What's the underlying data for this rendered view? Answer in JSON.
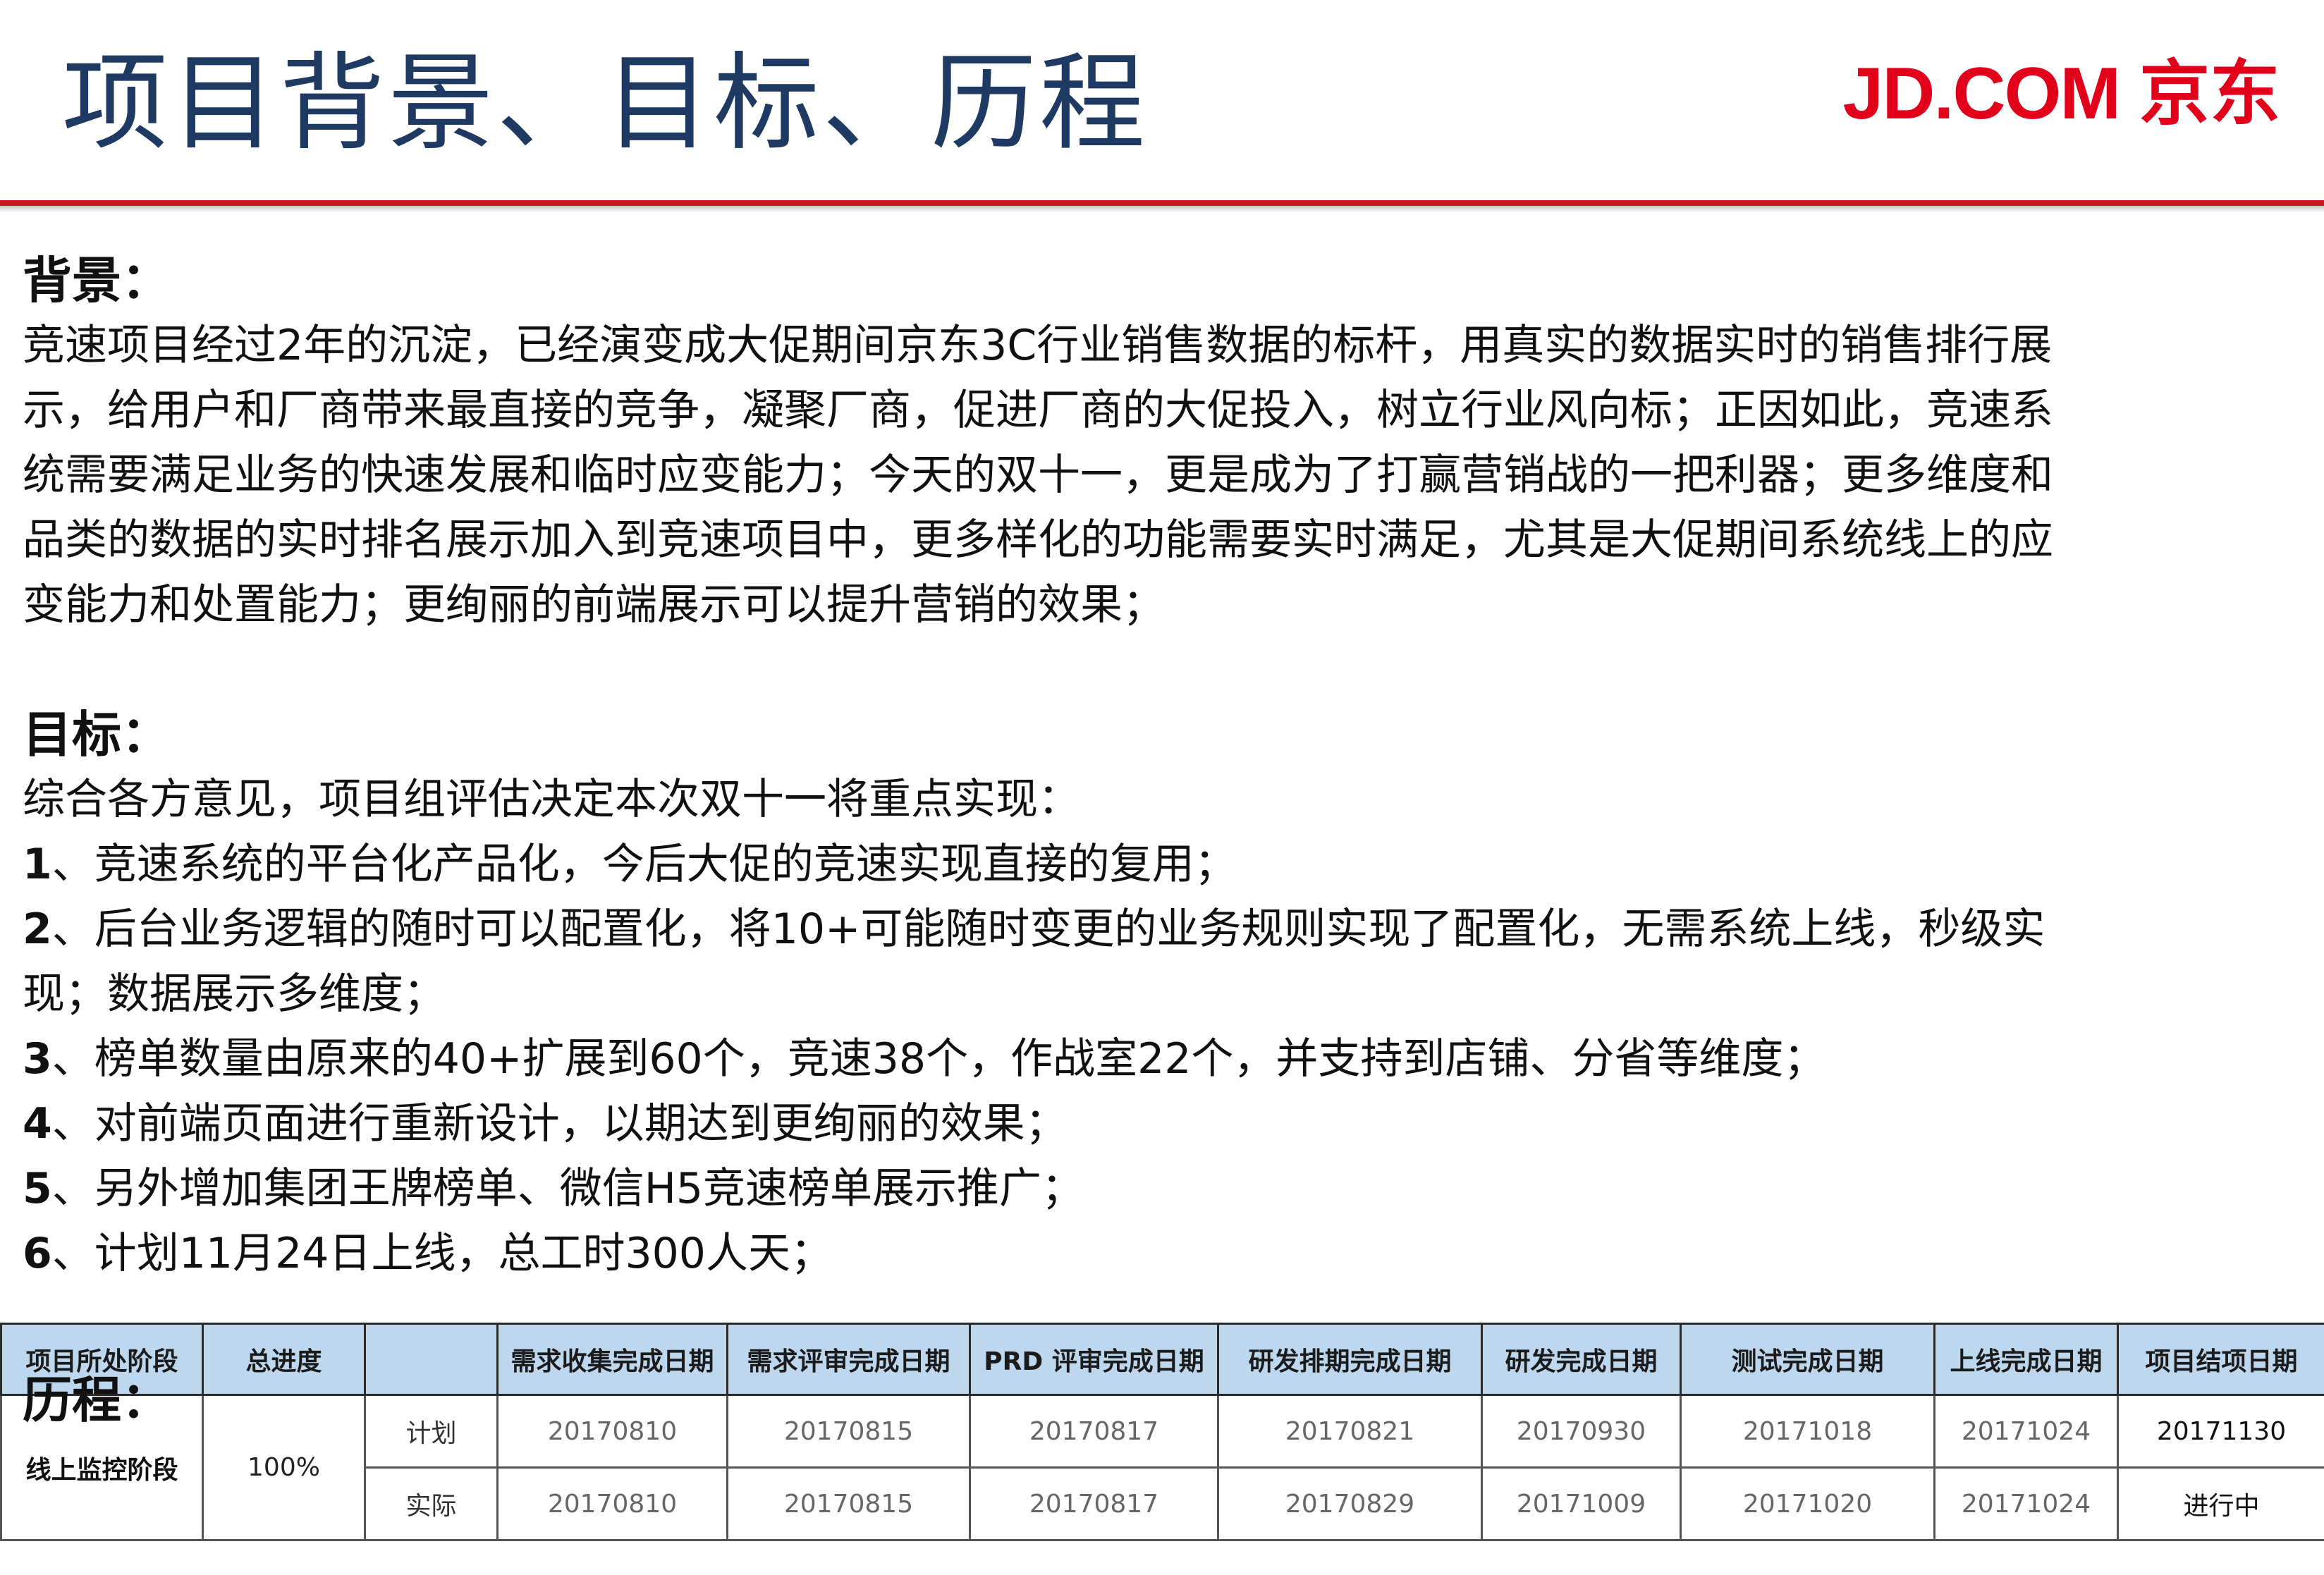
{
  "header": {
    "title": "项目背景、目标、历程",
    "logo_latin": "JD.COM",
    "logo_cjk": "京东",
    "accent_color": "#c8171e",
    "title_color": "#1f3a62"
  },
  "background": {
    "heading": "背景：",
    "lines": [
      "竞速项目经过2年的沉淀，已经演变成大促期间京东3C行业销售数据的标杆，用真实的数据实时的销售排行展",
      "示，给用户和厂商带来最直接的竞争，凝聚厂商，促进厂商的大促投入，树立行业风向标；正因如此，竞速系",
      "统需要满足业务的快速发展和临时应变能力；今天的双十一，更是成为了打赢营销战的一把利器；更多维度和",
      "品类的数据的实时排名展示加入到竞速项目中，更多样化的功能需要实时满足，尤其是大促期间系统线上的应",
      "变能力和处置能力；更绚丽的前端展示可以提升营销的效果；"
    ]
  },
  "goals": {
    "heading": "目标：",
    "intro": "综合各方意见，项目组评估决定本次双十一将重点实现：",
    "items": [
      {
        "num": "1",
        "text": "、竞速系统的平台化产品化，今后大促的竞速实现直接的复用；"
      },
      {
        "num": "2",
        "text": "、后台业务逻辑的随时可以配置化，将10+可能随时变更的业务规则实现了配置化，无需系统上线，秒级实"
      },
      {
        "num": "",
        "text": "现；数据展示多维度；"
      },
      {
        "num": "3",
        "text": "、榜单数量由原来的40+扩展到60个，竞速38个，作战室22个，并支持到店铺、分省等维度；"
      },
      {
        "num": "4",
        "text": "、对前端页面进行重新设计，以期达到更绚丽的效果；"
      },
      {
        "num": "5",
        "text": "、另外增加集团王牌榜单、微信H5竞速榜单展示推广；"
      },
      {
        "num": "6",
        "text": "、计划11月24日上线，总工时300人天；"
      }
    ]
  },
  "history": {
    "heading": "历程："
  },
  "table": {
    "header_color": "#bcd7ee",
    "headers": [
      "项目所处阶段",
      "总进度",
      "",
      "需求收集完成日期",
      "需求评审完成日期",
      "PRD 评审完成日期",
      "研发排期完成日期",
      "研发完成日期",
      "测试完成日期",
      "上线完成日期",
      "项目结项日期"
    ],
    "stage": "线上监控阶段",
    "progress": "100%",
    "rows": [
      {
        "label": "计划",
        "values": [
          "20170810",
          "20170815",
          "20170817",
          "20170821",
          "20170930",
          "20171018",
          "20171024",
          "20171130"
        ]
      },
      {
        "label": "实际",
        "values": [
          "20170810",
          "20170815",
          "20170817",
          "20170829",
          "20171009",
          "20171020",
          "20171024",
          "进行中"
        ]
      }
    ]
  }
}
